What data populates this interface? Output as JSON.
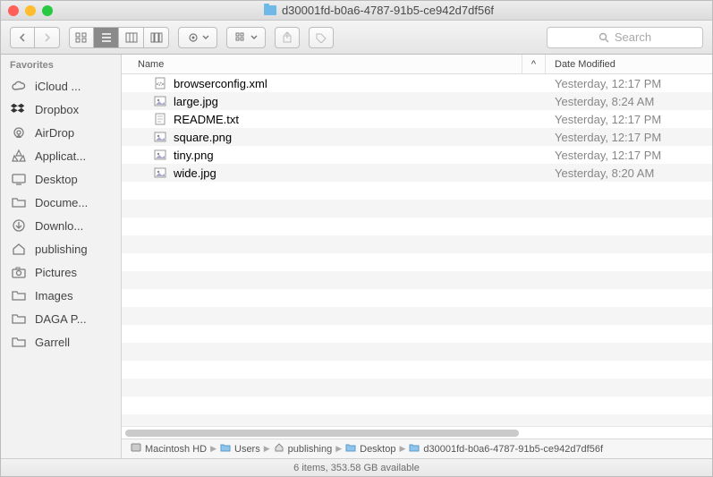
{
  "window": {
    "title": "d30001fd-b0a6-4787-91b5-ce942d7df56f"
  },
  "toolbar": {
    "search_placeholder": "Search"
  },
  "sidebar": {
    "header": "Favorites",
    "items": [
      {
        "label": "iCloud ...",
        "icon": "cloud"
      },
      {
        "label": "Dropbox",
        "icon": "dropbox"
      },
      {
        "label": "AirDrop",
        "icon": "airdrop"
      },
      {
        "label": "Applicat...",
        "icon": "apps"
      },
      {
        "label": "Desktop",
        "icon": "desktop"
      },
      {
        "label": "Docume...",
        "icon": "folder"
      },
      {
        "label": "Downlo...",
        "icon": "download"
      },
      {
        "label": "publishing",
        "icon": "home"
      },
      {
        "label": "Pictures",
        "icon": "camera"
      },
      {
        "label": "Images",
        "icon": "folder"
      },
      {
        "label": "DAGA P...",
        "icon": "folder"
      },
      {
        "label": "Garrell",
        "icon": "folder"
      }
    ]
  },
  "columns": {
    "name": "Name",
    "sort_indicator": "^",
    "date": "Date Modified"
  },
  "files": [
    {
      "name": "browserconfig.xml",
      "date": "Yesterday, 12:17 PM",
      "type": "xml"
    },
    {
      "name": "large.jpg",
      "date": "Yesterday, 8:24 AM",
      "type": "image"
    },
    {
      "name": "README.txt",
      "date": "Yesterday, 12:17 PM",
      "type": "text"
    },
    {
      "name": "square.png",
      "date": "Yesterday, 12:17 PM",
      "type": "image"
    },
    {
      "name": "tiny.png",
      "date": "Yesterday, 12:17 PM",
      "type": "image"
    },
    {
      "name": "wide.jpg",
      "date": "Yesterday, 8:20 AM",
      "type": "image"
    }
  ],
  "path": [
    {
      "label": "Macintosh HD",
      "icon": "disk"
    },
    {
      "label": "Users",
      "icon": "folder"
    },
    {
      "label": "publishing",
      "icon": "home"
    },
    {
      "label": "Desktop",
      "icon": "folder"
    },
    {
      "label": "d30001fd-b0a6-4787-91b5-ce942d7df56f",
      "icon": "folder"
    }
  ],
  "status": "6 items, 353.58 GB available"
}
